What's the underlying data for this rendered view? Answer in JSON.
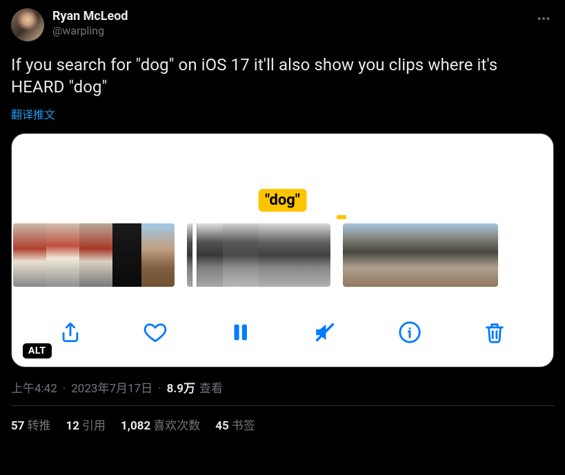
{
  "author": {
    "display_name": "Ryan McLeod",
    "handle": "@warpling"
  },
  "tweet": {
    "text": "If you search for \"dog\" on iOS 17 it'll also show you clips where it's HEARD \"dog\"",
    "translate_link": "翻译推文"
  },
  "media": {
    "search_label": "\"dog\"",
    "alt_badge": "ALT",
    "icons": {
      "share": "share-icon",
      "like": "heart-icon",
      "pause": "pause-icon",
      "mute": "speaker-muted-icon",
      "info": "info-icon",
      "trash": "trash-icon"
    }
  },
  "meta": {
    "time": "上午4:42",
    "date": "2023年7月17日",
    "views_count": "8.9万",
    "views_label": "查看"
  },
  "stats": {
    "retweets": {
      "count": "57",
      "label": "转推"
    },
    "quotes": {
      "count": "12",
      "label": "引用"
    },
    "likes": {
      "count": "1,082",
      "label": "喜欢次数"
    },
    "bookmarks": {
      "count": "45",
      "label": "书签"
    }
  }
}
